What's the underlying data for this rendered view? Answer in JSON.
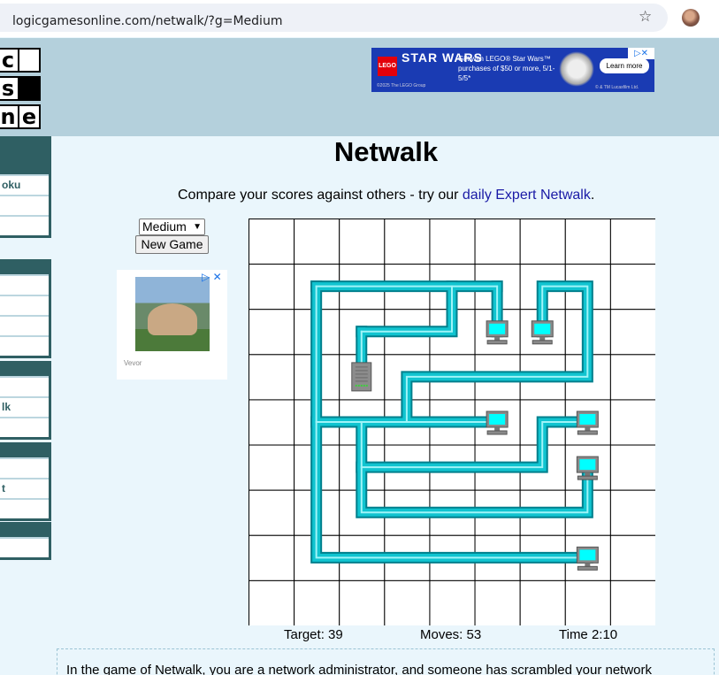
{
  "browser": {
    "url": "logicgamesonline.com/netwalk/?g=Medium"
  },
  "logo": {
    "letters": [
      "c",
      "",
      "s",
      "",
      "n",
      "e"
    ]
  },
  "header_ad": {
    "brand": "LEGO",
    "title": "STAR WARS",
    "text": "Gift with LEGO® Star Wars™ purchases of $50 or more, 5/1-5/5*",
    "cta": "Learn more",
    "fine_left": "©2025 The LEGO Group",
    "fine_right": "© & TM Lucasfilm Ltd."
  },
  "sidebar": {
    "items": [
      "oku",
      "lk",
      "t"
    ]
  },
  "page": {
    "title": "Netwalk",
    "compare_text": "Compare your scores against others - try our ",
    "compare_link": "daily Expert Netwalk",
    "compare_end": "."
  },
  "controls": {
    "difficulty": "Medium",
    "new_game": "New Game"
  },
  "side_ad": {
    "brand": "Vevor"
  },
  "board": {
    "cols": 9,
    "rows": 9,
    "pipe_color": "#10c4d0",
    "computer_color": "#00ffff",
    "pipes": [
      [
        [
          1,
          1
        ],
        [
          2,
          1
        ],
        [
          3,
          1
        ],
        [
          4,
          1
        ],
        [
          5,
          1
        ]
      ],
      [
        [
          1,
          1
        ],
        [
          1,
          7
        ],
        [
          7,
          7
        ]
      ],
      [
        [
          1,
          4
        ],
        [
          5,
          4
        ]
      ],
      [
        [
          2,
          2
        ],
        [
          2,
          3
        ]
      ],
      [
        [
          2,
          2
        ],
        [
          4,
          2
        ],
        [
          4,
          1
        ]
      ],
      [
        [
          5,
          1
        ],
        [
          5,
          2
        ]
      ],
      [
        [
          6,
          2
        ],
        [
          6,
          1
        ],
        [
          7,
          1
        ],
        [
          7,
          3
        ],
        [
          3,
          3
        ],
        [
          3,
          4
        ]
      ],
      [
        [
          2,
          4
        ],
        [
          2,
          6
        ],
        [
          7,
          6
        ],
        [
          7,
          5
        ]
      ],
      [
        [
          2,
          5
        ],
        [
          6,
          5
        ],
        [
          6,
          4
        ],
        [
          7,
          4
        ]
      ]
    ],
    "server": [
      2,
      3
    ],
    "computers": [
      [
        5,
        2
      ],
      [
        6,
        2
      ],
      [
        5,
        4
      ],
      [
        7,
        4
      ],
      [
        7,
        5
      ],
      [
        7,
        7
      ]
    ],
    "target": 39,
    "moves": 53,
    "time": "2:10"
  },
  "status": {
    "target": "Target: 39",
    "moves": "Moves: 53",
    "time": "Time 2:10"
  },
  "description": "In the game of Netwalk, you are a network administrator, and someone has scrambled your network"
}
